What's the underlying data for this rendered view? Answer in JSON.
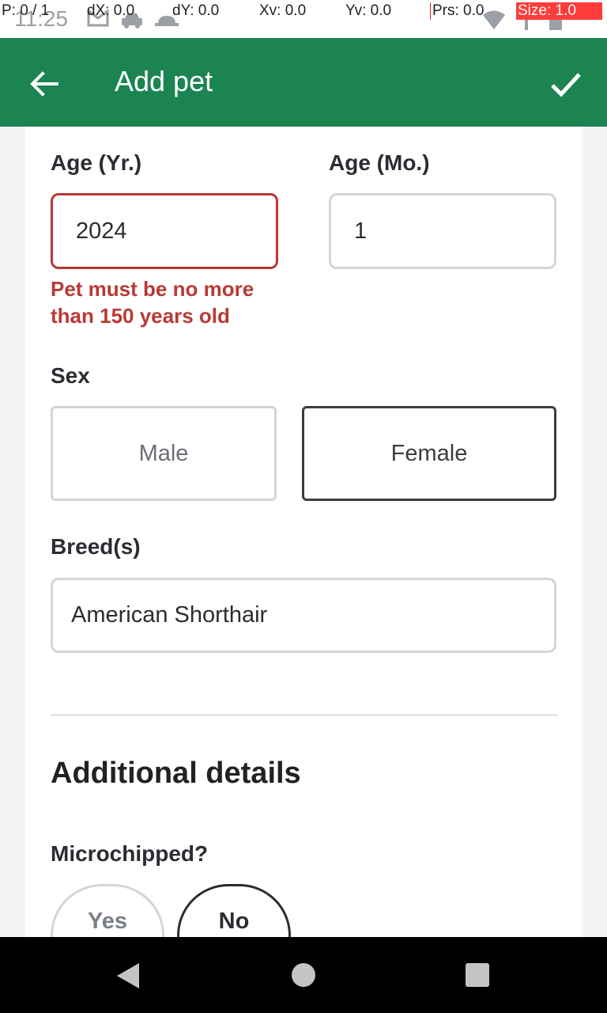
{
  "status_bar": {
    "time": "11:25",
    "debug": {
      "pointer": "P: 0 / 1",
      "dx": "dX: 0.0",
      "dy": "dY: 0.0",
      "xv": "Xv: 0.0",
      "yv": "Yv: 0.0",
      "prs": "Prs: 0.0",
      "size": "Size: 1.0"
    }
  },
  "app_bar": {
    "title": "Add pet",
    "back_icon": "arrow-left-icon",
    "confirm_icon": "check-icon"
  },
  "form": {
    "age_years": {
      "label": "Age (Yr.)",
      "value": "2024",
      "error": "Pet must be no more than 150 years old"
    },
    "age_months": {
      "label": "Age (Mo.)",
      "value": "1"
    },
    "sex": {
      "label": "Sex",
      "options": [
        "Male",
        "Female"
      ],
      "selected": "Female"
    },
    "breeds": {
      "label": "Breed(s)",
      "value": "American Shorthair"
    }
  },
  "additional_details": {
    "title": "Additional details",
    "microchipped": {
      "label": "Microchipped?",
      "options": [
        "Yes",
        "No"
      ],
      "selected": "No"
    }
  },
  "colors": {
    "primary": "#1b8451",
    "error": "#b83a35",
    "border": "#d1d5db",
    "selected_border": "#3a3d42"
  }
}
